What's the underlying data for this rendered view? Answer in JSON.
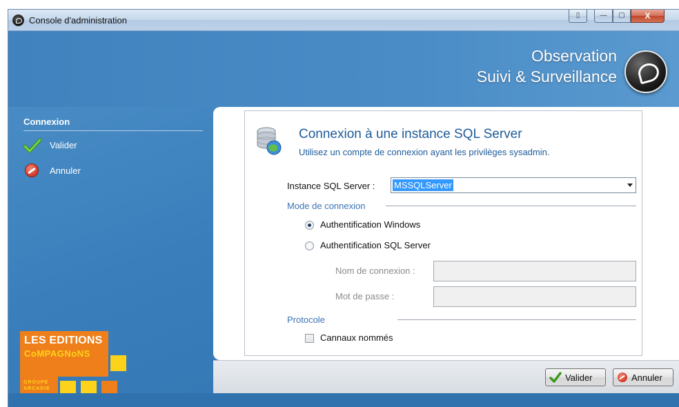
{
  "window": {
    "title": "Console d'administration",
    "controls": {
      "extra": "▯",
      "minimize": "—",
      "maximize": "▢",
      "close": "X"
    }
  },
  "banner": {
    "line1": "Observation",
    "line2": "Suivi & Surveillance"
  },
  "sidebar": {
    "section": "Connexion",
    "items": [
      {
        "label": "Valider",
        "icon": "check-icon"
      },
      {
        "label": "Annuler",
        "icon": "cancel-icon"
      }
    ]
  },
  "company_logo": {
    "line1": "LES EDITIONS",
    "line2": "CoMPAGNoNS",
    "line3": "GROUPE ARCADIE"
  },
  "form": {
    "title": "Connexion à une instance SQL Server",
    "subtitle": "Utilisez un compte de connexion ayant les privilèges sysadmin.",
    "instance_label": "Instance SQL Server :",
    "instance_value": "MSSQLServer",
    "mode_section": "Mode de connexion",
    "radio_windows": "Authentification Windows",
    "radio_sql": "Authentification SQL Server",
    "login_label": "Nom de connexion :",
    "password_label": "Mot de passe :",
    "protocol_section": "Protocole",
    "named_pipes_label": "Cannaux nommés"
  },
  "footer": {
    "ok_label": "Valider",
    "cancel_label": "Annuler"
  },
  "colors": {
    "blue_bg": "#3f80b9",
    "accent_text": "#1e5b9a",
    "section_text": "#3b73b6",
    "logo_orange": "#ef7f1a",
    "logo_yellow": "#fcd21a"
  }
}
